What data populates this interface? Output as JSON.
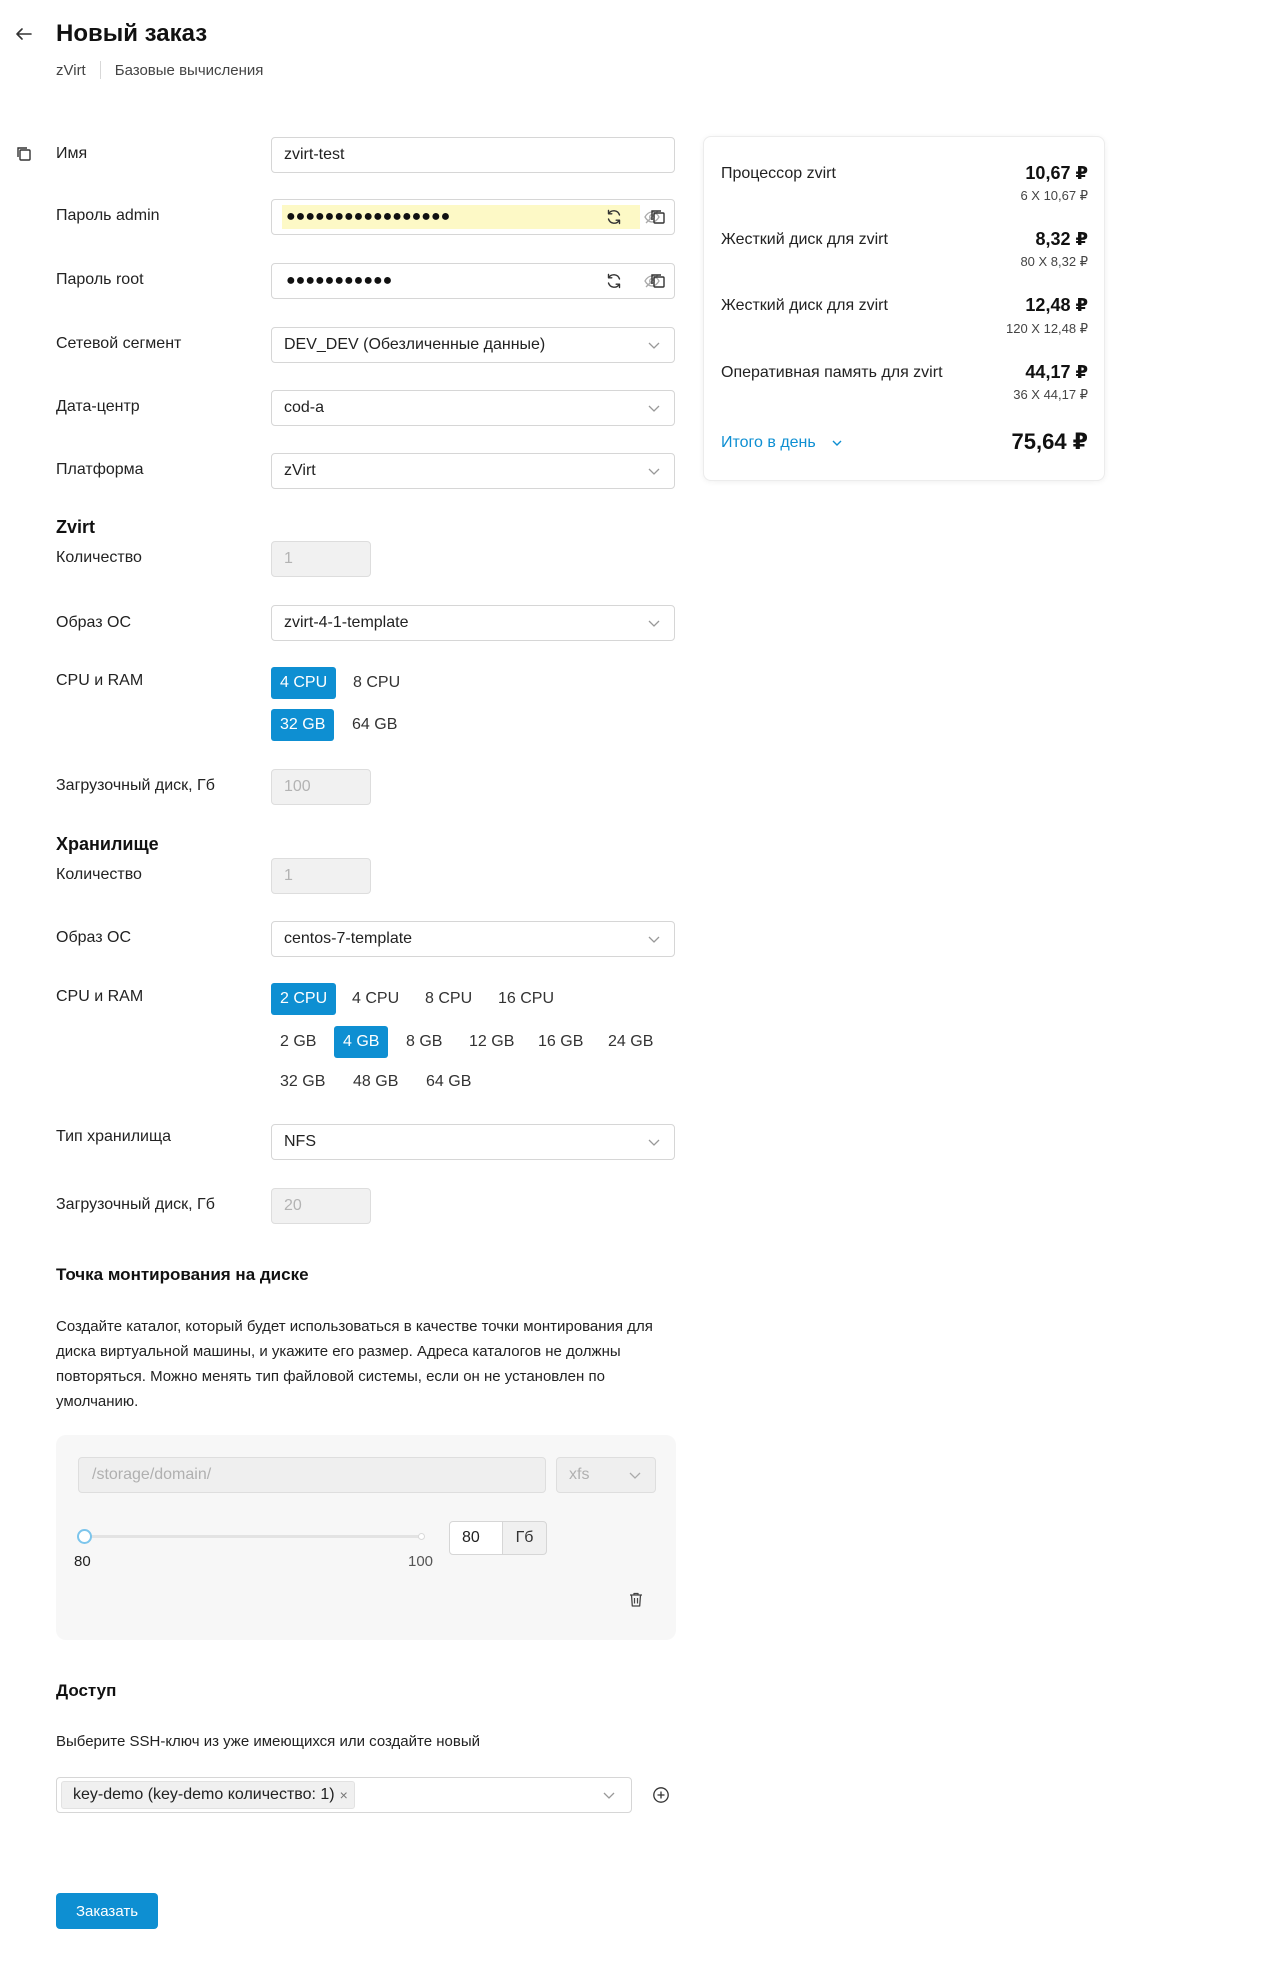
{
  "header": {
    "title": "Новый заказ",
    "breadcrumb": [
      "zVirt",
      "Базовые вычисления"
    ]
  },
  "form": {
    "name": {
      "label": "Имя",
      "value": "zvirt-test"
    },
    "admin_password": {
      "label": "Пароль admin",
      "value": "●●●●●●●●●●●●●●●●●"
    },
    "root_password": {
      "label": "Пароль root",
      "value": "●●●●●●●●●●●"
    },
    "network": {
      "label": "Сетевой сегмент",
      "value": "DEV_DEV (Обезличенные данные)"
    },
    "datacenter": {
      "label": "Дата-центр",
      "value": "cod-a"
    },
    "platform": {
      "label": "Платформа",
      "value": "zVirt"
    }
  },
  "zvirt": {
    "title": "Zvirt",
    "quantity": {
      "label": "Количество",
      "value": "1"
    },
    "os_image": {
      "label": "Образ ОС",
      "value": "zvirt-4-1-template"
    },
    "cpu_ram_label": "CPU и RAM",
    "cpu_options": [
      "4 CPU",
      "8 CPU"
    ],
    "ram_options": [
      "32 GB",
      "64 GB"
    ],
    "boot_disk": {
      "label": "Загрузочный диск, Гб",
      "value": "100"
    }
  },
  "storage": {
    "title": "Хранилище",
    "quantity": {
      "label": "Количество",
      "value": "1"
    },
    "os_image": {
      "label": "Образ ОС",
      "value": "centos-7-template"
    },
    "cpu_ram_label": "CPU и RAM",
    "cpu_options": [
      "2 CPU",
      "4 CPU",
      "8 CPU",
      "16 CPU"
    ],
    "ram_options_row1": [
      "2 GB",
      "4 GB",
      "8 GB",
      "12 GB",
      "16 GB",
      "24 GB"
    ],
    "ram_options_row2": [
      "32 GB",
      "48 GB",
      "64 GB"
    ],
    "storage_type": {
      "label": "Тип хранилища",
      "value": "NFS"
    },
    "boot_disk": {
      "label": "Загрузочный диск, Гб",
      "value": "20"
    }
  },
  "mount": {
    "title": "Точка монтирования на диске",
    "description": "Создайте каталог, который будет использоваться в качестве точки монтирования для диска виртуальной машины, и укажите его размер. Адреса каталогов не должны повторяться. Можно менять тип файловой системы, если он не установлен по умолчанию.",
    "path_placeholder": "/storage/domain/",
    "fs_type": "xfs",
    "slider_min": "80",
    "slider_max": "100",
    "slider_value_fraction": 0,
    "size_value": "80",
    "size_unit": "Гб"
  },
  "access": {
    "title": "Доступ",
    "description": "Выберите SSH-ключ из уже имеющихся или создайте новый",
    "selected_key": "key-demo (key-demo количество: 1)",
    "remove_symbol": "×"
  },
  "submit_label": "Заказать",
  "summary": {
    "items": [
      {
        "name": "Процессор zvirt",
        "price": "10,67 ₽",
        "detail": "6 X 10,67 ₽"
      },
      {
        "name": "Жесткий диск для zvirt",
        "price": "8,32 ₽",
        "detail": "80 X 8,32 ₽"
      },
      {
        "name": "Жесткий диск для zvirt",
        "price": "12,48 ₽",
        "detail": "120 X 12,48 ₽"
      },
      {
        "name": "Оперативная память для zvirt",
        "price": "44,17 ₽",
        "detail": "36 X 44,17 ₽"
      }
    ],
    "total_label": "Итого в день",
    "total_value": "75,64 ₽"
  },
  "colors": {
    "accent": "#0e8fd2",
    "highlight": "#fdf9c6"
  }
}
